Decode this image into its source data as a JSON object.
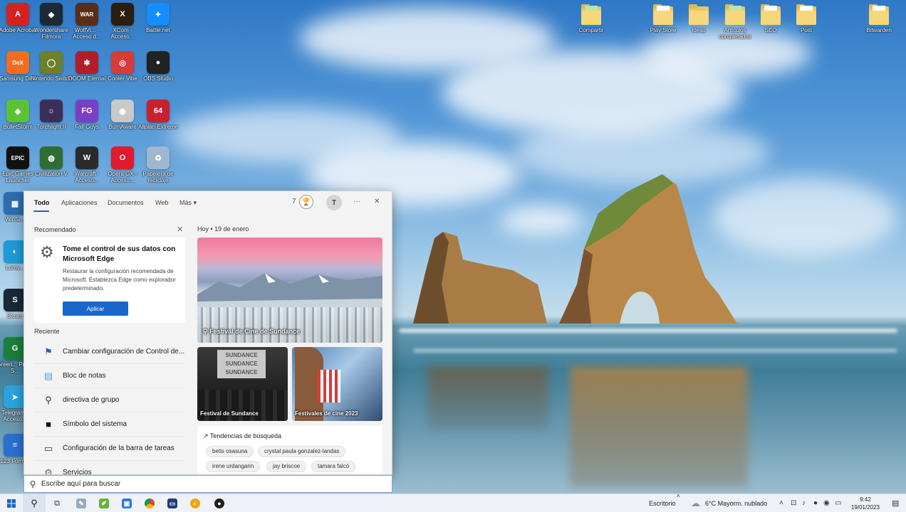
{
  "desktop": {
    "left_icons": [
      {
        "label": "Adobe Acrobat",
        "glyph": "A",
        "color": "#d42121"
      },
      {
        "label": "Wondershare Filmora",
        "glyph": "◆",
        "color": "#1c2a35"
      },
      {
        "label": "WolfVi... - Acceso d...",
        "glyph": "WAR",
        "color": "#5a2c1a"
      },
      {
        "label": "XCom - Acceso...",
        "glyph": "X",
        "color": "#2b1d10"
      },
      {
        "label": "Battle.net",
        "glyph": "✦",
        "color": "#148eff"
      },
      {
        "label": "Samsung DeX",
        "glyph": "DeX",
        "color": "#f36c21"
      },
      {
        "label": "Nintendo Switch",
        "glyph": "◯",
        "color": "#6c7f2a"
      },
      {
        "label": "DOOM Eternal",
        "glyph": "✱",
        "color": "#b21d2b"
      },
      {
        "label": "Cooler Vibe",
        "glyph": "◎",
        "color": "#d93a3a"
      },
      {
        "label": "OBS Studio",
        "glyph": "●",
        "color": "#222222"
      },
      {
        "label": "BulletStorm",
        "glyph": "◆",
        "color": "#5bc236"
      },
      {
        "label": "Torchlight II",
        "glyph": "☼",
        "color": "#3b2e58"
      },
      {
        "label": "Fall Guys",
        "glyph": "FG",
        "color": "#7c3fc4"
      },
      {
        "label": "BurnAware",
        "glyph": "◉",
        "color": "#c9c9c9"
      },
      {
        "label": "Allplan Extreme",
        "glyph": "64",
        "color": "#c8202f"
      },
      {
        "label": "Epic Games Launcher",
        "glyph": "EPIC",
        "color": "#111111"
      },
      {
        "label": "Civilization V",
        "glyph": "◍",
        "color": "#2f6e33"
      },
      {
        "label": "Warcraft - Acceso...",
        "glyph": "W",
        "color": "#2a2a2a"
      },
      {
        "label": "Opera GX - Acceso...",
        "glyph": "O",
        "color": "#e01b2b"
      },
      {
        "label": "Papelera de reciclaje",
        "glyph": "♻",
        "color": "#9fb8cf"
      },
      {
        "label": "WinSi...",
        "glyph": "▦",
        "color": "#2c6db0"
      },
      {
        "label": "Lumy...",
        "glyph": "◐",
        "color": "#1d9bd6"
      },
      {
        "label": "Steam",
        "glyph": "S",
        "color": "#1b2838"
      },
      {
        "label": "Green... Proxy S...",
        "glyph": "G",
        "color": "#1c7f3a"
      },
      {
        "label": "Telegram - Acceso...",
        "glyph": "➤",
        "color": "#2aa3e0"
      },
      {
        "label": "123 Form...",
        "glyph": "≡",
        "color": "#2b6fd4"
      }
    ],
    "right_icons": [
      {
        "label": "Compartir",
        "paper": "green"
      },
      {
        "label": "Play Store",
        "paper": "white"
      },
      {
        "label": "Ideas",
        "paper": "none"
      },
      {
        "label": "Artículos completados",
        "paper": "green"
      },
      {
        "label": "SEO",
        "paper": "white"
      },
      {
        "label": "Post",
        "paper": "white"
      },
      {
        "label": "Bitwarden",
        "paper": "white"
      }
    ]
  },
  "panel": {
    "tabs": [
      "Todo",
      "Aplicaciones",
      "Documentos",
      "Web",
      "Más ▾"
    ],
    "reward_count": "7",
    "avatar_initial": "T",
    "more_label": "···",
    "close_label": "✕",
    "recommended": {
      "section_label": "Recomendado",
      "title": "Tome el control de sus datos con Microsoft Edge",
      "description": "Restaurar la configuración recomendada de Microsoft. Establezca Edge como explorador predeterminado.",
      "button": "Aplicar",
      "dismiss": "✕"
    },
    "recent": {
      "section_label": "Reciente",
      "items": [
        {
          "label": "Cambiar configuración de Control de...",
          "icon": "flag-icon"
        },
        {
          "label": "Bloc de notas",
          "icon": "notepad-icon"
        },
        {
          "label": "directiva de grupo",
          "icon": "search-icon"
        },
        {
          "label": "Símbolo del sistema",
          "icon": "terminal-icon"
        },
        {
          "label": "Configuración de la barra de tareas",
          "icon": "taskbar-icon"
        },
        {
          "label": "Servicios",
          "icon": "gear-icon"
        }
      ]
    },
    "news": {
      "date_label": "Hoy  •  19 de enero",
      "featured": "Festival de Cine de Sundance",
      "card_left": "Festival de Sundance",
      "card_left_overlay": "SUNDANCE",
      "card_right": "Festivales de cine 2023",
      "trends_title": "↗ Tendencias de búsqueda",
      "trends": [
        "betis osasuna",
        "crystal paula gonzalez-landas",
        "irene urdangarin",
        "jay briscoe",
        "tamara falcó"
      ]
    }
  },
  "searchbar": {
    "placeholder": "Escribe aquí para buscar"
  },
  "taskbar": {
    "desktop_label": "Escritorio",
    "weather": "6°C  Mayorm. nublado",
    "time": "9:42",
    "date": "19/01/2023",
    "overflow_caret": "˄"
  }
}
